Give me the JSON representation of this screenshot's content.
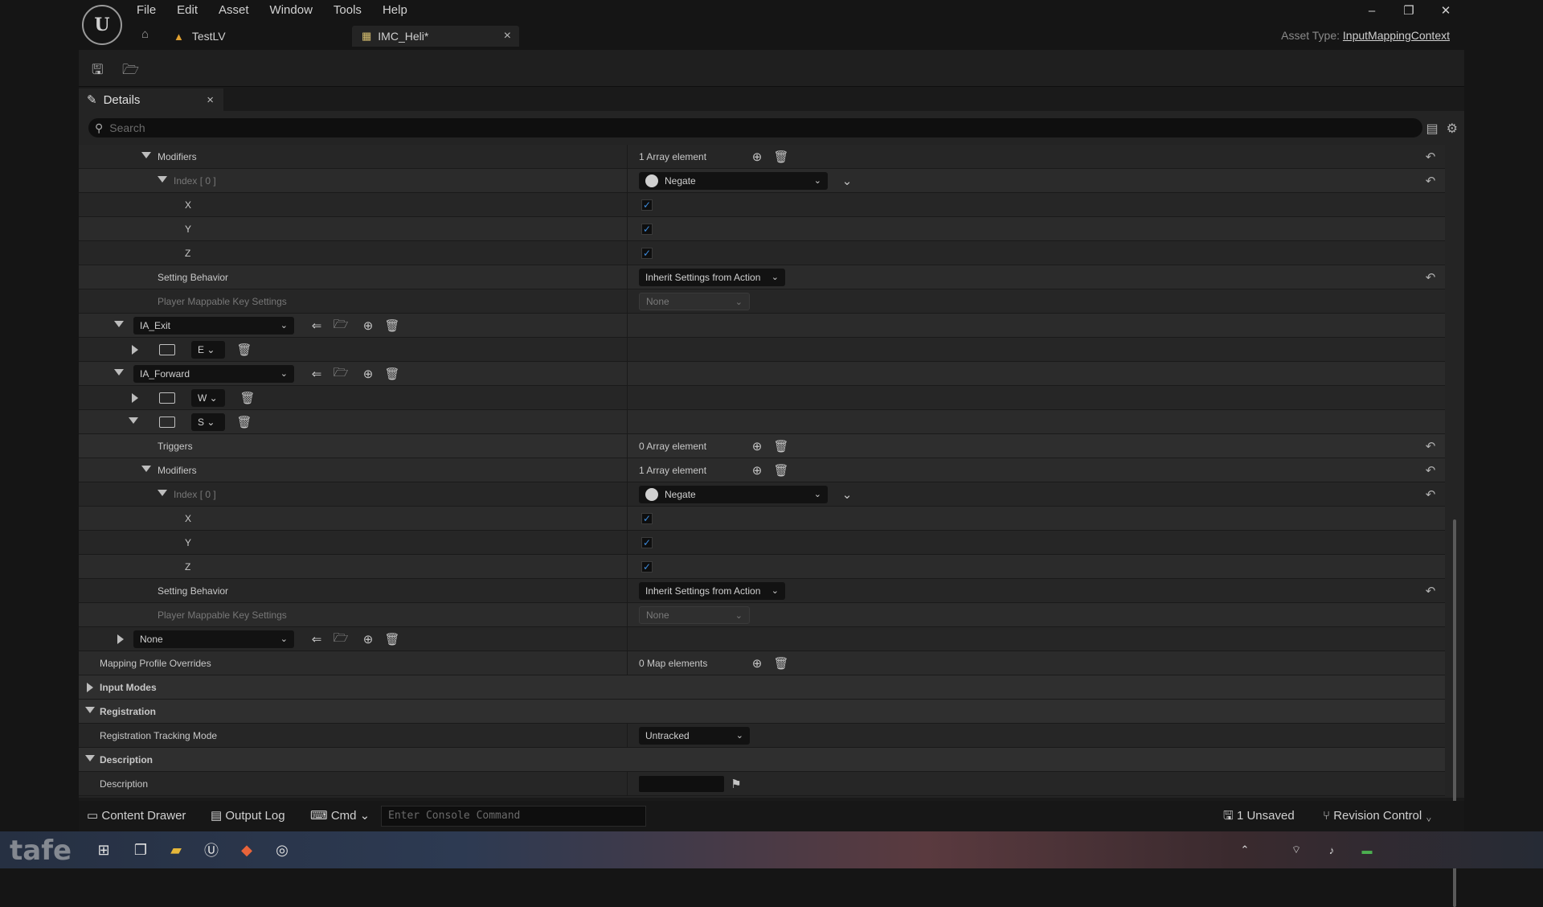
{
  "app": {
    "logo": "U",
    "menu": [
      "File",
      "Edit",
      "Asset",
      "Window",
      "Tools",
      "Help"
    ],
    "tabs": [
      {
        "label": "TestLV",
        "icon": "level-icon"
      },
      {
        "label": "IMC_Heli*",
        "icon": "input-mapping-icon",
        "close": "×"
      }
    ],
    "asset_type_label": "Asset Type:",
    "asset_type_value": "InputMappingContext",
    "window_controls": [
      "–",
      "❐",
      "✕"
    ]
  },
  "panel": {
    "tab_label": "Details",
    "tab_close": "×",
    "search_placeholder": "Search"
  },
  "rows": {
    "modifiers1": {
      "label": "Modifiers",
      "value": "1 Array element"
    },
    "index1": {
      "label": "Index [ 0 ]",
      "value": "Negate"
    },
    "x1": {
      "label": "X",
      "checked": true
    },
    "y1": {
      "label": "Y",
      "checked": true
    },
    "z1": {
      "label": "Z",
      "checked": true
    },
    "setting1": {
      "label": "Setting Behavior",
      "value": "Inherit Settings from Action"
    },
    "player1": {
      "label": "Player Mappable Key Settings",
      "value": "None"
    },
    "ia_exit": {
      "label": "IA_Exit"
    },
    "key_e": {
      "label": "E"
    },
    "ia_forward": {
      "label": "IA_Forward"
    },
    "key_w": {
      "label": "W"
    },
    "key_s": {
      "label": "S"
    },
    "triggers": {
      "label": "Triggers",
      "value": "0 Array element"
    },
    "modifiers2": {
      "label": "Modifiers",
      "value": "1 Array element"
    },
    "index2": {
      "label": "Index [ 0 ]",
      "value": "Negate"
    },
    "x2": {
      "label": "X",
      "checked": true
    },
    "y2": {
      "label": "Y",
      "checked": true
    },
    "z2": {
      "label": "Z",
      "checked": true
    },
    "setting2": {
      "label": "Setting Behavior",
      "value": "Inherit Settings from Action"
    },
    "player2": {
      "label": "Player Mappable Key Settings",
      "value": "None"
    },
    "none_mapping": {
      "label": "None"
    },
    "profile_overrides": {
      "label": "Mapping Profile Overrides",
      "value": "0 Map elements"
    },
    "input_modes": {
      "label": "Input Modes"
    },
    "registration": {
      "label": "Registration"
    },
    "tracking_mode": {
      "label": "Registration Tracking Mode",
      "value": "Untracked"
    },
    "description_cat": {
      "label": "Description"
    },
    "description": {
      "label": "Description",
      "value": ""
    }
  },
  "statusbar": {
    "content_drawer": "Content Drawer",
    "output_log": "Output Log",
    "cmd": "Cmd",
    "console_placeholder": "Enter Console Command",
    "unsaved": "1 Unsaved",
    "revision_control": "Revision Control"
  },
  "taskbar": {
    "watermark": "tafe"
  },
  "colors": {
    "checkbox_accent": "#3d8bdc",
    "panel_bg": "#242424"
  }
}
